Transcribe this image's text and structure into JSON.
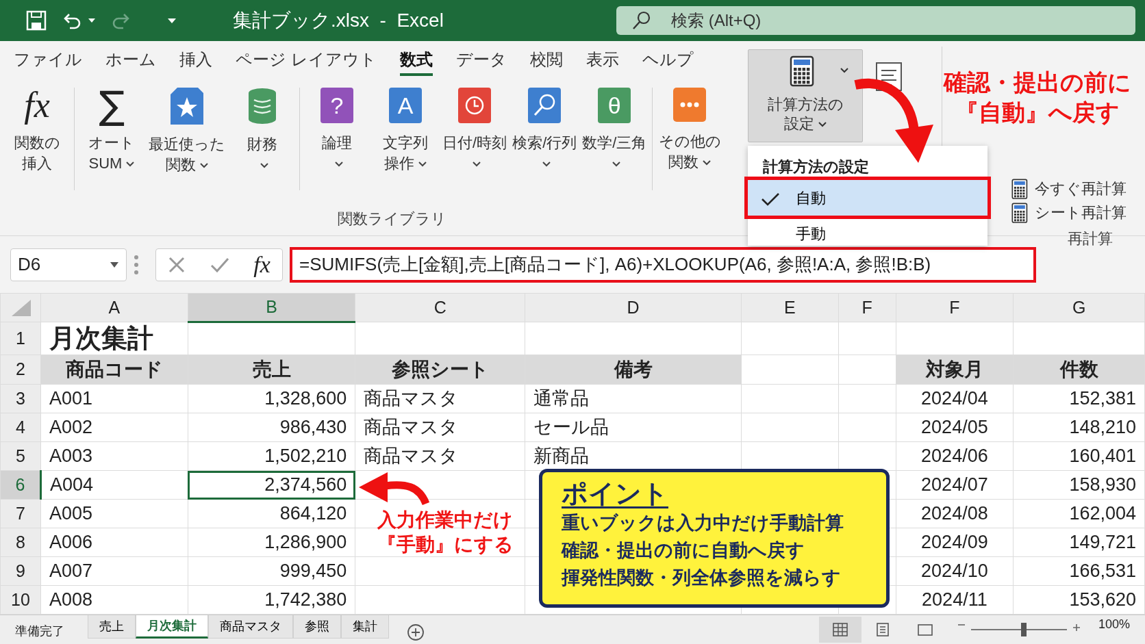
{
  "title_bar": {
    "quick_access": [
      {
        "kind": "save",
        "disabled": false
      },
      {
        "kind": "undo",
        "disabled": false
      },
      {
        "kind": "redo",
        "disabled": true
      },
      {
        "kind": "customize",
        "disabled": false
      }
    ],
    "title": "集計ブック.xlsx  -  Excel",
    "search": {
      "placeholder": "検索 (Alt+Q)"
    }
  },
  "ribbon_tabs": [
    {
      "label": "ファイル",
      "selected": false
    },
    {
      "label": "ホーム",
      "selected": false
    },
    {
      "label": "挿入",
      "selected": false
    },
    {
      "label": "ページ レイアウト",
      "selected": false
    },
    {
      "label": "数式",
      "selected": true
    },
    {
      "label": "データ",
      "selected": false
    },
    {
      "label": "校閲",
      "selected": false
    },
    {
      "label": "表示",
      "selected": false
    },
    {
      "label": "ヘルプ",
      "selected": false
    }
  ],
  "function_library": {
    "label": "関数ライブラリ",
    "buttons": [
      {
        "kind": "fx",
        "glyph": "fx",
        "label": [
          "関数の",
          "挿入"
        ],
        "has_menu": false,
        "divider_before": false
      },
      {
        "kind": "sigma",
        "glyph": "∑",
        "label": [
          "オート",
          "SUM"
        ],
        "has_menu": true,
        "divider_before": true
      },
      {
        "kind": "star",
        "label": [
          "最近使った",
          "関数"
        ],
        "has_menu": true,
        "divider_before": false
      },
      {
        "kind": "database",
        "label": [
          "財務"
        ],
        "has_menu": true,
        "divider_before": false
      },
      {
        "kind": "question",
        "glyph": "?",
        "label": [
          "論理"
        ],
        "has_menu": true,
        "divider_before": true
      },
      {
        "kind": "letter",
        "glyph": "A",
        "label": [
          "文字列",
          "操作"
        ],
        "has_menu": true,
        "divider_before": false
      },
      {
        "kind": "clock",
        "label": [
          "日付/時刻"
        ],
        "has_menu": true,
        "divider_before": false
      },
      {
        "kind": "search",
        "label": [
          "検索/行列"
        ],
        "has_menu": true,
        "divider_before": false
      },
      {
        "kind": "theta",
        "glyph": "θ",
        "label": [
          "数学/三角"
        ],
        "has_menu": true,
        "divider_before": false
      },
      {
        "kind": "more",
        "label": [
          "その他の",
          "関数"
        ],
        "has_menu": true,
        "divider_before": true
      }
    ]
  },
  "calculation": {
    "button": {
      "label": [
        "計算方法の",
        "設定"
      ]
    },
    "menu": {
      "title": "計算方法の設定",
      "items": [
        {
          "label": "自動",
          "selected": true
        },
        {
          "label": "手動",
          "selected": false
        }
      ]
    }
  },
  "recalculation": {
    "label": "再計算",
    "buttons": [
      {
        "label": "今すぐ再計算"
      },
      {
        "label": "シート再計算"
      }
    ]
  },
  "callouts": [
    {
      "kind": "ribbon_note",
      "lines": [
        "確認・提出の前に",
        "『自動』へ戻す"
      ]
    },
    {
      "kind": "cell_note",
      "lines": [
        "入力作業中だけ",
        "『手動』にする"
      ]
    }
  ],
  "formula_bar": {
    "name_box": "D6",
    "fx": "fx",
    "formula": "=SUMIFS(売上[金額],売上[商品コード], A6)+XLOOKUP(A6, 参照!A:A, 参照!B:B)"
  },
  "sheet": {
    "columns": [
      {
        "label": "A",
        "selected": false
      },
      {
        "label": "B",
        "selected": true
      },
      {
        "label": "C",
        "selected": false
      },
      {
        "label": "D",
        "selected": false
      },
      {
        "label": "E",
        "selected": false
      },
      {
        "label": "F",
        "selected": false
      },
      {
        "label": "F",
        "selected": false
      },
      {
        "label": "G",
        "selected": false
      }
    ],
    "rows": [
      {
        "number": "1",
        "selected": false,
        "kind": "title",
        "cells": [
          "月次集計",
          null,
          null,
          null,
          null,
          null,
          null,
          null
        ]
      },
      {
        "number": "2",
        "selected": false,
        "kind": "header",
        "cells": [
          "商品コード",
          "売上",
          "参照シート",
          "備考",
          null,
          null,
          "対象月",
          "件数"
        ]
      },
      {
        "number": "3",
        "selected": false,
        "kind": "data",
        "cells": [
          "A001",
          "1,328,600",
          "商品マスタ",
          "通常品",
          null,
          null,
          "2024/04",
          "152,381"
        ]
      },
      {
        "number": "4",
        "selected": false,
        "kind": "data",
        "cells": [
          "A002",
          "986,430",
          "商品マスタ",
          "セール品",
          null,
          null,
          "2024/05",
          "148,210"
        ]
      },
      {
        "number": "5",
        "selected": false,
        "kind": "data",
        "cells": [
          "A003",
          "1,502,210",
          "商品マスタ",
          "新商品",
          null,
          null,
          "2024/06",
          "160,401"
        ]
      },
      {
        "number": "6",
        "selected": true,
        "kind": "data",
        "cells": [
          "A004",
          "2,374,560",
          null,
          null,
          null,
          null,
          "2024/07",
          "158,930"
        ]
      },
      {
        "number": "7",
        "selected": false,
        "kind": "data",
        "cells": [
          "A005",
          "864,120",
          null,
          null,
          null,
          null,
          "2024/08",
          "162,004"
        ]
      },
      {
        "number": "8",
        "selected": false,
        "kind": "data",
        "cells": [
          "A006",
          "1,286,900",
          null,
          null,
          null,
          null,
          "2024/09",
          "149,721"
        ]
      },
      {
        "number": "9",
        "selected": false,
        "kind": "data",
        "cells": [
          "A007",
          "999,450",
          null,
          null,
          null,
          null,
          "2024/10",
          "166,531"
        ]
      },
      {
        "number": "10",
        "selected": false,
        "kind": "data",
        "cells": [
          "A008",
          "1,742,380",
          null,
          null,
          null,
          null,
          "2024/11",
          "153,620"
        ]
      }
    ]
  },
  "point_box": {
    "title": "ポイント",
    "lines": [
      "重いブックは入力中だけ手動計算",
      "確認・提出の前に自動へ戻す",
      "揮発性関数・列全体参照を減らす"
    ]
  },
  "status_bar": {
    "status": "準備完了",
    "sheets": [
      {
        "label": "売上",
        "selected": false
      },
      {
        "label": "月次集計",
        "selected": true
      },
      {
        "label": "商品マスタ",
        "selected": false
      },
      {
        "label": "参照",
        "selected": false
      },
      {
        "label": "集計",
        "selected": false
      }
    ],
    "views": [
      {
        "kind": "normal",
        "selected": true
      },
      {
        "kind": "page_layout",
        "selected": false
      },
      {
        "kind": "page_break",
        "selected": false
      }
    ],
    "zoom": {
      "level": 0.55,
      "reading": "100%"
    }
  }
}
